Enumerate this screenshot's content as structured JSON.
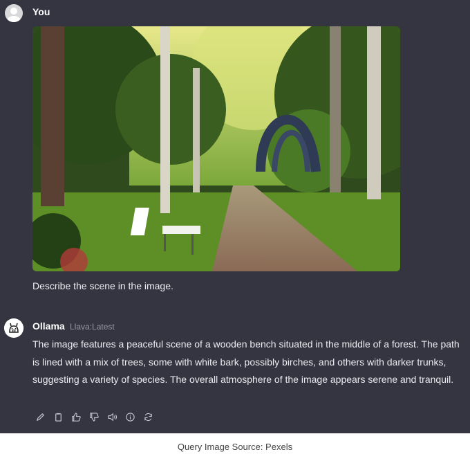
{
  "user": {
    "name": "You",
    "message": "Describe the scene in the image."
  },
  "assistant": {
    "name": "Ollama",
    "model": "Llava:Latest",
    "message": "The image features a peaceful scene of a wooden bench situated in the middle of a forest. The path is lined with a mix of trees, some with white bark, possibly birches, and others with darker trunks, suggesting a variety of species. The overall atmosphere of the image appears serene and tranquil."
  },
  "actions": [
    {
      "icon": "pencil-icon"
    },
    {
      "icon": "clipboard-icon"
    },
    {
      "icon": "thumbs-up-icon"
    },
    {
      "icon": "thumbs-down-icon"
    },
    {
      "icon": "speaker-icon"
    },
    {
      "icon": "info-icon"
    },
    {
      "icon": "regenerate-icon"
    }
  ],
  "caption": "Query Image Source: Pexels",
  "colors": {
    "chat_background": "#343541",
    "text": "#ececf1",
    "page_background": "#ffffff"
  }
}
